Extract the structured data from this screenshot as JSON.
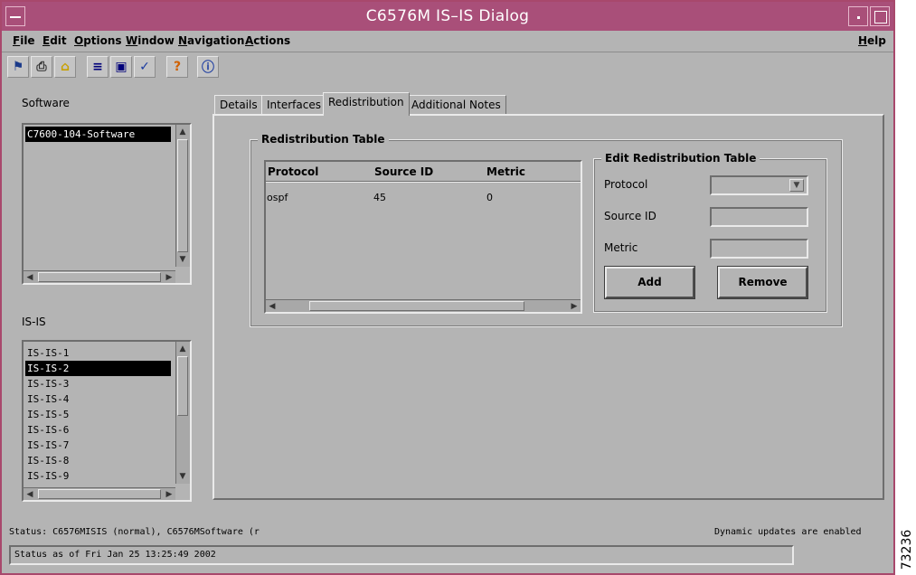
{
  "window": {
    "title": "C6576M IS–IS Dialog"
  },
  "menubar": {
    "items": [
      {
        "first": "F",
        "rest": "ile"
      },
      {
        "first": "E",
        "rest": "dit"
      },
      {
        "first": "O",
        "rest": "ptions"
      },
      {
        "first": "W",
        "rest": "indow"
      },
      {
        "first": "N",
        "rest": "avigation"
      },
      {
        "first": "A",
        "rest": "ctions"
      }
    ],
    "help": {
      "first": "H",
      "rest": "elp"
    }
  },
  "toolbar": {
    "icons": [
      "run-icon",
      "printer-icon",
      "folder-open-icon",
      "list-icon",
      "monitor-icon",
      "checkmark-icon",
      "help-question-icon",
      "info-icon"
    ],
    "glyphs": [
      "⚑",
      "⎙",
      "⌂",
      "≡",
      "▣",
      "✓",
      "?",
      "ⓘ"
    ]
  },
  "software": {
    "label": "Software",
    "items": [
      "C7600-104-Software"
    ],
    "selected": 0
  },
  "isis": {
    "label": "IS-IS",
    "items": [
      "IS-IS-1",
      "IS-IS-2",
      "IS-IS-3",
      "IS-IS-4",
      "IS-IS-5",
      "IS-IS-6",
      "IS-IS-7",
      "IS-IS-8",
      "IS-IS-9"
    ],
    "selected": 1
  },
  "tabs": [
    {
      "label": "Details",
      "active": false
    },
    {
      "label": "Interfaces",
      "active": false
    },
    {
      "label": "Redistribution",
      "active": true
    },
    {
      "label": "Additional Notes",
      "active": false
    }
  ],
  "redistribution": {
    "group_title": "Redistribution Table",
    "columns": [
      "Protocol",
      "Source ID",
      "Metric"
    ],
    "rows": [
      [
        "ospf",
        "45",
        "0"
      ]
    ],
    "edit": {
      "group_title": "Edit Redistribution Table",
      "protocol_label": "Protocol",
      "protocol_value": "",
      "source_id_label": "Source ID",
      "source_id_value": "",
      "metric_label": "Metric",
      "metric_value": "",
      "add_label": "Add",
      "remove_label": "Remove"
    }
  },
  "status": {
    "line": "Status: C6576MISIS (normal), C6576MSoftware (r",
    "updates": "Dynamic updates are enabled",
    "as_of": "Status as of Fri Jan 25 13:25:49 2002"
  },
  "figure_number": "73236",
  "colors": {
    "titlebar": "#a94f79",
    "window_bg": "#b4b4b4",
    "selection": "#000000"
  }
}
